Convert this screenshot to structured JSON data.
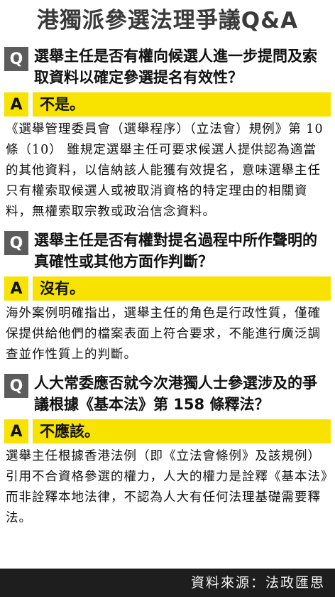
{
  "title": "港獨派參選法理爭議Q&A",
  "qa": [
    {
      "q_badge": "Q",
      "question": "選舉主任是否有權向候選人進一步提問及索取資料以確定參選提名有效性？",
      "a_badge": "A",
      "short_answer": "不是。",
      "answer": "《選舉管理委員會（選舉程序）（立法會）規例》第 10 條（10） 雖規定選舉主任可要求候選人提供認為適當的其他資料，以信納該人能獲有效提名，意味選舉主任只有權索取候選人或被取消資格的特定理由的相關資料，無權索取宗教或政治信念資料。"
    },
    {
      "q_badge": "Q",
      "question": "選舉主任是否有權對提名過程中所作聲明的真確性或其他方面作判斷？",
      "a_badge": "A",
      "short_answer": "沒有。",
      "answer": "海外案例明確指出，選舉主任的角色是行政性質，僅確保提供給他們的檔案表面上符合要求，不能進行廣泛調查並作性質上的判斷。"
    },
    {
      "q_badge": "Q",
      "question": "人大常委應否就今次港獨人士參選涉及的爭議根據《基本法》第 158 條釋法？",
      "a_badge": "A",
      "short_answer": "不應該。",
      "answer": "選舉主任根據香港法例（即《立法會條例》及該規例）引用不合資格參選的權力，人大的權力是詮釋《基本法》而非詮釋本地法律，不認為人大有任何法理基礎需要釋法。"
    }
  ],
  "source": "資料來源：法政匯思",
  "colors": {
    "q_badge_bg": "#5c5c5c",
    "answer_highlight": "#f7e200",
    "source_bar_bg": "#1e1e1e"
  }
}
